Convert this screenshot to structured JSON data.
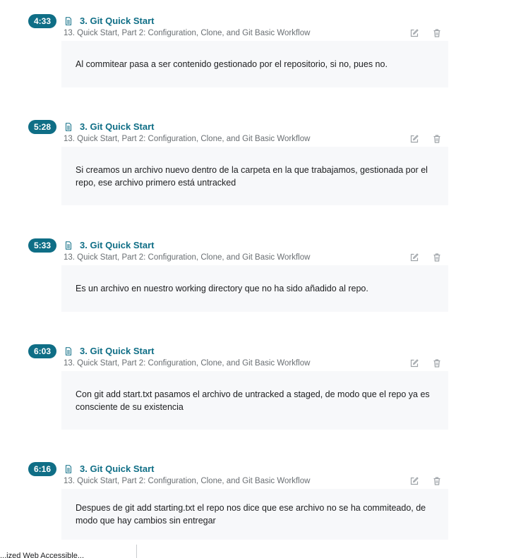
{
  "notes": [
    {
      "timestamp": "4:33",
      "section": "3. Git Quick Start",
      "lecture": "13. Quick Start, Part 2: Configuration, Clone, and Git Basic Workflow",
      "text": "Al commitear pasa a ser contenido gestionado por el repositorio, si no, pues no."
    },
    {
      "timestamp": "5:28",
      "section": "3. Git Quick Start",
      "lecture": "13. Quick Start, Part 2: Configuration, Clone, and Git Basic Workflow",
      "text": "Si creamos un archivo nuevo dentro de la carpeta en la que trabajamos, gestionada por el repo, ese archivo primero está untracked"
    },
    {
      "timestamp": "5:33",
      "section": "3. Git Quick Start",
      "lecture": "13. Quick Start, Part 2: Configuration, Clone, and Git Basic Workflow",
      "text": "Es un archivo en nuestro working directory que no ha sido añadido al repo."
    },
    {
      "timestamp": "6:03",
      "section": "3. Git Quick Start",
      "lecture": "13. Quick Start, Part 2: Configuration, Clone, and Git Basic Workflow",
      "text": "Con git add start.txt pasamos el archivo de untracked a staged, de modo que el repo ya es consciente de su existencia"
    },
    {
      "timestamp": "6:16",
      "section": "3. Git Quick Start",
      "lecture": "13. Quick Start, Part 2: Configuration, Clone, and Git Basic Workflow",
      "text": "Despues de git add starting.txt el repo nos dice que ese archivo no se ha commiteado, de modo que hay cambios sin entregar"
    }
  ],
  "icons": {
    "lecture": "document-icon",
    "edit": "edit-icon",
    "delete": "trash-icon"
  },
  "colors": {
    "accent": "#0f6e86",
    "note_bg": "#f7f8fa",
    "muted": "#6a6f73",
    "icon": "#9ea3a8"
  },
  "footer": {
    "fragment": "...ized Web Accessible..."
  }
}
